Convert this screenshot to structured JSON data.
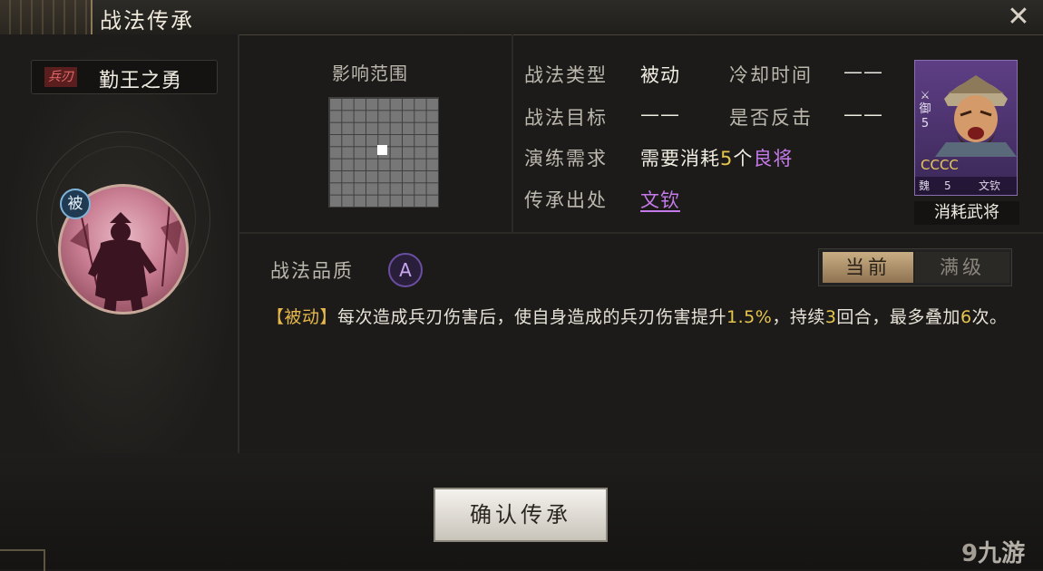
{
  "window": {
    "title": "战法传承",
    "close_glyph": "✕"
  },
  "skill": {
    "tag": "兵刃",
    "name": "勤王之勇",
    "type_badge": "被"
  },
  "range": {
    "label": "影响范围"
  },
  "info": {
    "type_label": "战法类型",
    "type_value": "被动",
    "cooldown_label": "冷却时间",
    "cooldown_value": "——",
    "target_label": "战法目标",
    "target_value": "——",
    "counter_label": "是否反击",
    "counter_value": "——",
    "req_label": "演练需求",
    "req_prefix": "需要消耗",
    "req_count": "5",
    "req_unit": "个",
    "req_quality": "良将",
    "source_label": "传承出处",
    "source_value": "文钦"
  },
  "card": {
    "side_text": "御",
    "side_num": "5",
    "stars": "CCCC",
    "faction": "魏",
    "cost": "5",
    "name": "文钦",
    "caption": "消耗武将",
    "icon": "sword-icon"
  },
  "quality": {
    "label": "战法品质",
    "grade": "A"
  },
  "toggle": {
    "current": "当前",
    "max": "满级"
  },
  "description": {
    "tag": "【被动】",
    "part1": "每次造成兵刃伤害后，使自身造成的兵刃伤害提升",
    "pct": "1.5%",
    "part2": "，持续",
    "turns": "3",
    "part3": "回合，最多叠加",
    "stacks": "6",
    "part4": "次。"
  },
  "footer": {
    "confirm": "确认传承"
  },
  "watermark": {
    "icon": "9",
    "text": "九游"
  },
  "colors": {
    "accent_gold": "#e6c64e",
    "quality_purple": "#c47ae8",
    "tag_red": "#e26a6a",
    "toggle_active": "#c9ae84"
  }
}
